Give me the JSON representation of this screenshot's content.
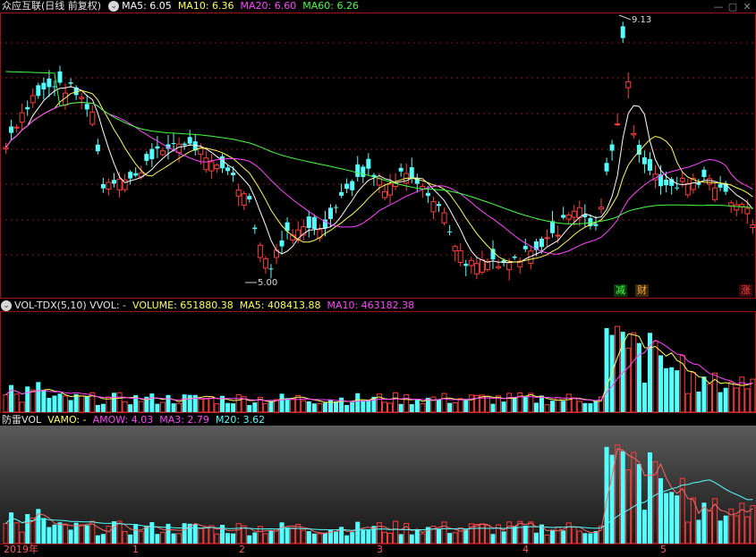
{
  "main": {
    "stock_title": "众应互联(日线 前复权)",
    "ma5": "MA5: 6.05",
    "ma10": "MA10: 6.36",
    "ma20": "MA20: 6.60",
    "ma60": "MA60: 6.26",
    "high_label": "9.13",
    "low_label": "5.00",
    "tags": {
      "reduce": "减",
      "finance": "财",
      "rise": "涨"
    }
  },
  "volume": {
    "title": "VOL-TDX(5,10) VVOL: -",
    "volume": "VOLUME: 651880.38",
    "ma5": "MA5: 408413.88",
    "ma10": "MA10: 463182.38"
  },
  "fanglei": {
    "title": "防雷VOL",
    "vamo": "VAMO: -",
    "amow": "AMOW: 4.03",
    "ma3": "MA3: 2.79",
    "m20": "M20: 3.62"
  },
  "xaxis": [
    "2019年",
    "1",
    "2",
    "3",
    "4",
    "5"
  ],
  "colors": {
    "up": "#ff3c3c",
    "down": "#54ffff",
    "ma5": "#ffffff",
    "ma10": "#ffff55",
    "ma20": "#ff44ff",
    "ma60": "#44ff44",
    "grid": "#8b1a1a"
  },
  "icons": {
    "collapse": "chevron-down-icon",
    "minimize": "minimize-icon",
    "maximize": "maximize-icon",
    "close": "close-icon"
  }
}
